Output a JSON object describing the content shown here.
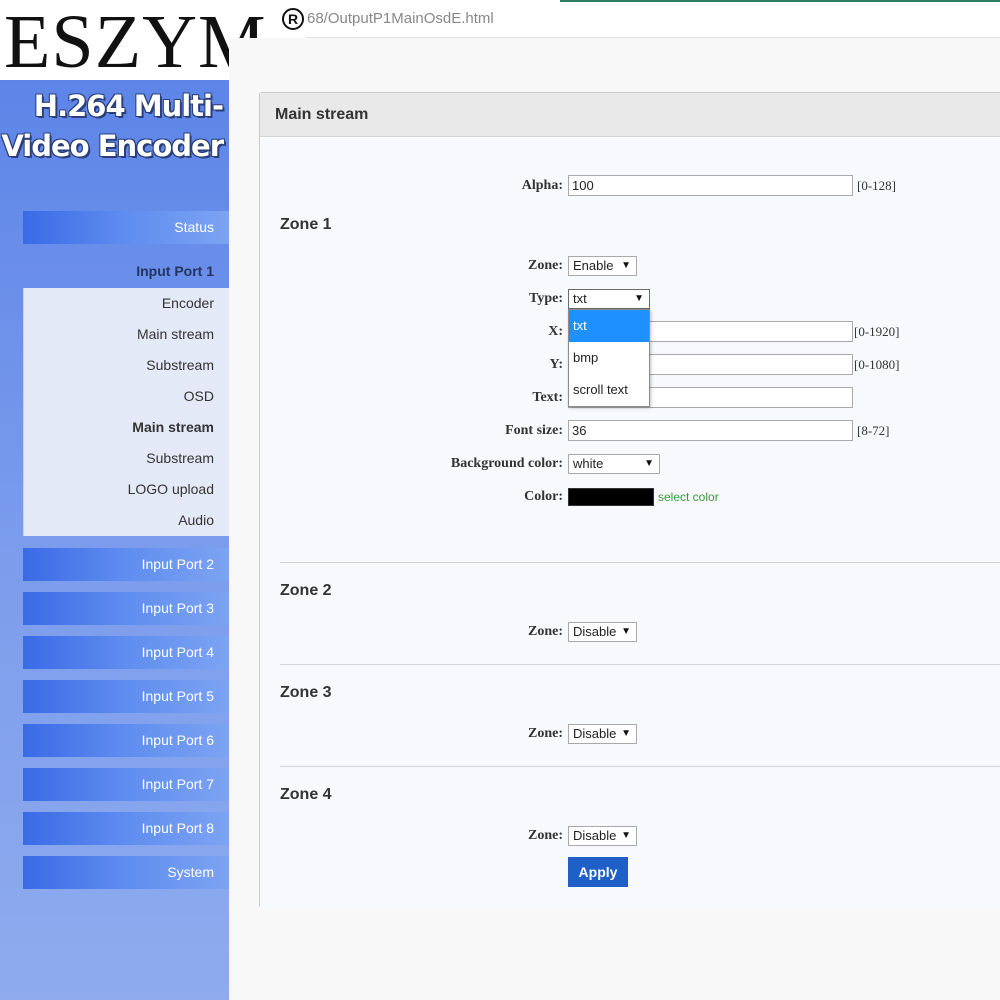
{
  "browser": {
    "url": "68/OutputP1MainOsdE.html"
  },
  "logo": {
    "text": "ESZYM",
    "mark": "R"
  },
  "sidebar": {
    "brand_line1": "H.264 Multi-",
    "brand_line2": "Video Encoder",
    "status_label": "Status",
    "port1_title": "Input Port 1",
    "port1_items": [
      "Encoder",
      "Main stream",
      "Substream",
      "OSD",
      "Main stream",
      "Substream",
      "LOGO upload",
      "Audio"
    ],
    "ports": [
      "Input Port 2",
      "Input Port 3",
      "Input Port 4",
      "Input Port 5",
      "Input Port 6",
      "Input Port 7",
      "Input Port 8"
    ],
    "system_label": "System"
  },
  "panel": {
    "title": "Main stream",
    "alpha_label": "Alpha:",
    "alpha_value": "100",
    "alpha_range": "[0-128]",
    "zone1": {
      "title": "Zone 1",
      "zone_label": "Zone:",
      "zone_value": "Enable",
      "type_label": "Type:",
      "type_value": "txt",
      "type_options": [
        "txt",
        "bmp",
        "scroll text"
      ],
      "x_label": "X:",
      "x_range": "[0-1920]",
      "y_label": "Y:",
      "y_range": "[0-1080]",
      "text_label": "Text:",
      "fontsize_label": "Font size:",
      "fontsize_value": "36",
      "fontsize_range": "[8-72]",
      "bg_label": "Background color:",
      "bg_value": "white",
      "color_label": "Color:",
      "color_value": "#000000",
      "select_color": "select color"
    },
    "zone2": {
      "title": "Zone 2",
      "zone_label": "Zone:",
      "zone_value": "Disable"
    },
    "zone3": {
      "title": "Zone 3",
      "zone_label": "Zone:",
      "zone_value": "Disable"
    },
    "zone4": {
      "title": "Zone 4",
      "zone_label": "Zone:",
      "zone_value": "Disable"
    },
    "apply_label": "Apply"
  },
  "colors": {
    "sidebar_top": "#5d85e8",
    "nav_button": "#3a6ae6",
    "apply_button": "#1f5fc8",
    "dropdown_selected": "#1e90ff",
    "select_color_link": "#3a9a3a"
  }
}
